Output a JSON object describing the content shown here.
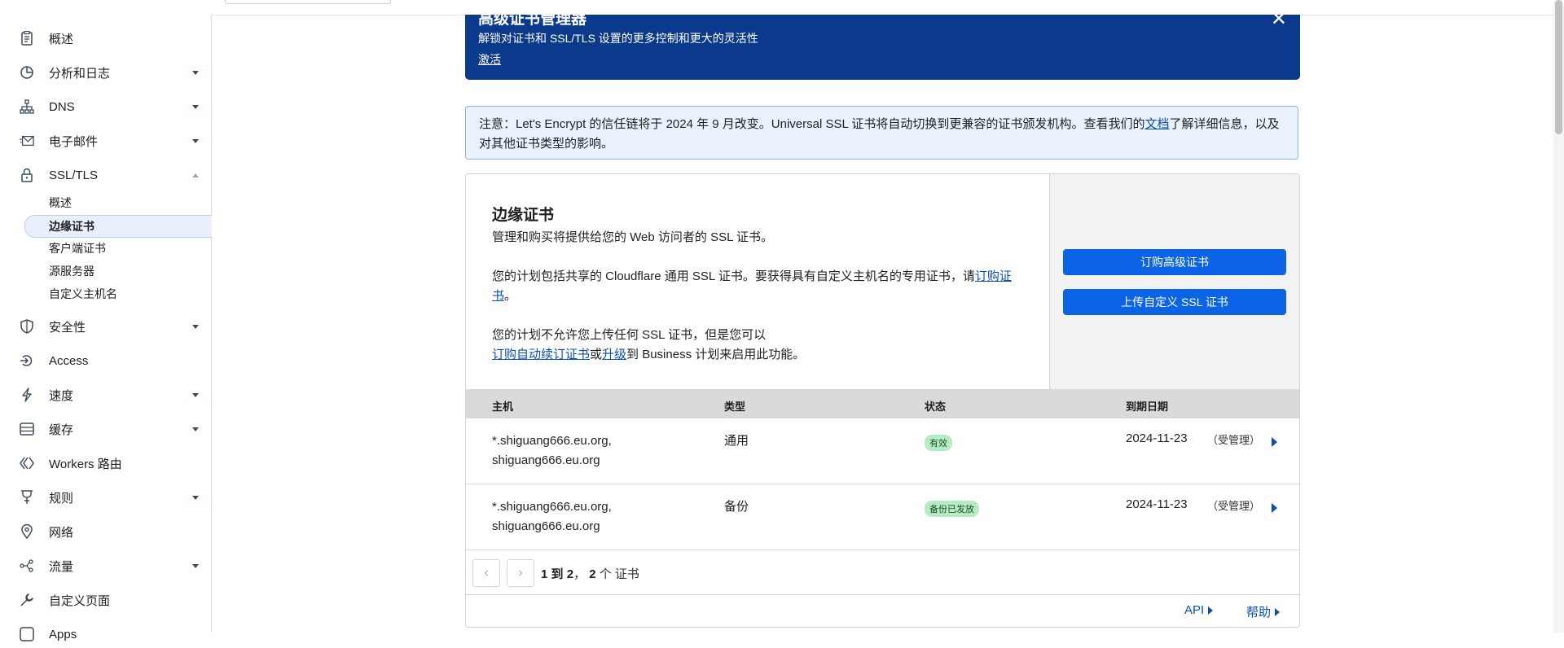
{
  "sidebar": {
    "items": [
      {
        "label": "概述",
        "icon": "document-icon",
        "caret": false
      },
      {
        "label": "分析和日志",
        "icon": "pie-chart-icon",
        "caret": true
      },
      {
        "label": "DNS",
        "icon": "network-icon",
        "caret": true
      },
      {
        "label": "电子邮件",
        "icon": "mail-icon",
        "caret": true
      },
      {
        "label": "SSL/TLS",
        "icon": "lock-icon",
        "caret": "up"
      },
      {
        "label": "安全性",
        "icon": "shield-icon",
        "caret": true
      },
      {
        "label": "Access",
        "icon": "access-icon",
        "caret": false
      },
      {
        "label": "速度",
        "icon": "lightning-icon",
        "caret": true
      },
      {
        "label": "缓存",
        "icon": "storage-icon",
        "caret": true
      },
      {
        "label": "Workers 路由",
        "icon": "workers-icon",
        "caret": false
      },
      {
        "label": "规则",
        "icon": "rules-icon",
        "caret": true
      },
      {
        "label": "网络",
        "icon": "location-pin-icon",
        "caret": false
      },
      {
        "label": "流量",
        "icon": "traffic-icon",
        "caret": true
      },
      {
        "label": "自定义页面",
        "icon": "wrench-icon",
        "caret": false
      },
      {
        "label": "Apps",
        "icon": "apps-icon",
        "caret": false
      }
    ],
    "ssl_sub": [
      {
        "label": "概述",
        "active": false
      },
      {
        "label": "边缘证书",
        "active": true
      },
      {
        "label": "客户端证书",
        "active": false
      },
      {
        "label": "源服务器",
        "active": false
      },
      {
        "label": "自定义主机名",
        "active": false
      }
    ]
  },
  "banner": {
    "title": "高级证书管理器",
    "description": "解锁对证书和 SSL/TLS 设置的更多控制和更大的灵活性",
    "link": "激活",
    "close": "✕"
  },
  "notice": {
    "text_before": "注意：Let's Encrypt 的信任链将于 2024 年 9 月改变。Universal SSL 证书将自动切换到更兼容的证书颁发机构。查看我们的",
    "link": "文档",
    "text_after": "了解详细信息，以及对其他证书类型的影响。"
  },
  "card": {
    "title": "边缘证书",
    "desc": "管理和购买将提供给您的 Web 访问者的 SSL 证书。",
    "para2_text": "您的计划包括共享的 Cloudflare 通用 SSL 证书。要获得具有自定义主机名的专用证书，请",
    "para2_link": "订购证书",
    "para2_end": "。",
    "para3_line1": "您的计划不允许您上传任何 SSL 证书，但是您可以",
    "para3_link1": "订购自动续订证书",
    "para3_or": "或",
    "para3_link2": "升级",
    "para3_end": "到 Business 计划来启用此功能。",
    "btn_order": "订购高级证书",
    "btn_upload": "上传自定义 SSL 证书"
  },
  "table": {
    "headers": [
      "主机",
      "类型",
      "状态",
      "到期日期"
    ],
    "rows": [
      {
        "host1": "*.shiguang666.eu.org,",
        "host2": "shiguang666.eu.org",
        "type": "通用",
        "status": "有效",
        "expires": "2024-11-23",
        "managed": "（受管理）"
      },
      {
        "host1": "*.shiguang666.eu.org,",
        "host2": "shiguang666.eu.org",
        "type": "备份",
        "status": "备份已发放",
        "expires": "2024-11-23",
        "managed": "（受管理）"
      }
    ]
  },
  "pager": {
    "prev": "‹",
    "next": "›",
    "from": "1",
    "to_word": "到",
    "to": "2",
    "sep": "，",
    "total": "2",
    "unit": "个 证书"
  },
  "footer": {
    "api": "API",
    "help": "帮助"
  },
  "colors": {
    "banner": "#0b3a8c",
    "accent": "#0b63e5",
    "link": "#0b4fb5",
    "badge": "#b5ecc3"
  }
}
